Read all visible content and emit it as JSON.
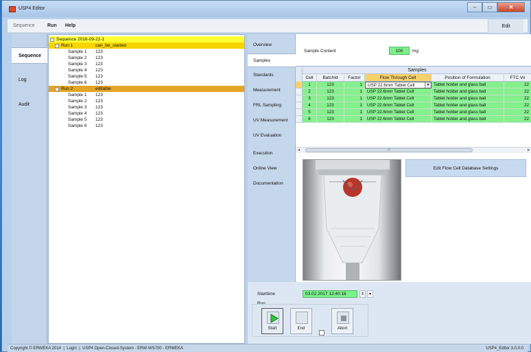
{
  "window": {
    "title": "USP4 Editor"
  },
  "menu": {
    "items": [
      "Sequence",
      "Run",
      "Help"
    ],
    "edit_label": "Edit"
  },
  "left_nav": {
    "items": [
      "Sequence",
      "Log",
      "Audit"
    ],
    "active": "Sequence"
  },
  "tree": {
    "sequence": "Sequence 2016-09-22-1",
    "runs": [
      {
        "name": "Run 1",
        "status": "can_be_started",
        "samples": [
          {
            "name": "Sample 1",
            "value": "123"
          },
          {
            "name": "Sample 2",
            "value": "123"
          },
          {
            "name": "Sample 3",
            "value": "123"
          },
          {
            "name": "Sample 4",
            "value": "123"
          },
          {
            "name": "Sample 5",
            "value": "123"
          },
          {
            "name": "Sample 6",
            "value": "123"
          }
        ]
      },
      {
        "name": "Run 2",
        "status": "editable",
        "samples": [
          {
            "name": "Sample 1",
            "value": "123"
          },
          {
            "name": "Sample 2",
            "value": "123"
          },
          {
            "name": "Sample 3",
            "value": "123"
          },
          {
            "name": "Sample 4",
            "value": "123"
          },
          {
            "name": "Sample 5",
            "value": "123"
          },
          {
            "name": "Sample 6",
            "value": "123"
          }
        ]
      }
    ]
  },
  "right_nav": {
    "items": [
      "Overview",
      "Samples",
      "Standards",
      "Measurement",
      "FRL Sampling",
      "UV Measurement",
      "UV Evaluation",
      "Execution",
      "Online View",
      "Documentation"
    ],
    "active": "Samples"
  },
  "samples": {
    "content_label": "Sample Content",
    "content_value": "100",
    "content_unit": "mg",
    "grid_title": "Samples",
    "columns": [
      "Cell",
      "BatchId",
      "Factor",
      "Flow Through Cell",
      "Position of Formulation",
      "FTC Vo"
    ],
    "rows": [
      [
        "1",
        "123",
        "1",
        "USP 22.6mm Tablet Cell",
        "Tablet holder and glass ball",
        "22"
      ],
      [
        "2",
        "123",
        "1",
        "USP 22.6mm Tablet Cell",
        "Tablet holder and glass ball",
        "22"
      ],
      [
        "3",
        "123",
        "1",
        "USP 22.6mm Tablet Cell",
        "Tablet holder and glass ball",
        "22"
      ],
      [
        "4",
        "123",
        "1",
        "USP 22.6mm Tablet Cell",
        "Tablet holder and glass ball",
        "22"
      ],
      [
        "5",
        "123",
        "1",
        "USP 22.6mm Tablet Cell",
        "Tablet holder and glass ball",
        "22"
      ],
      [
        "6",
        "123",
        "1",
        "USP 22.6mm Tablet Cell",
        "Tablet holder and glass ball",
        "22"
      ]
    ],
    "selected_column": "Flow Through Cell",
    "edit_flow_button": "Edit Flow Cell Database Settings"
  },
  "execution": {
    "starttime_label": "Starttime",
    "starttime_value": "03.02.2017 12:40:18",
    "run_label": "Run",
    "buttons": {
      "start": "Start",
      "end": "End",
      "abort": "Abort"
    }
  },
  "status": {
    "left": "Copyright © ERWEKA 2014  |  Login  |  USP4 Open-Closed-System - ERW-WS700 - ERWEKA",
    "right": "USP4_Editor 3.0.0.0"
  },
  "colors": {
    "selection_yellow": "#ffff32",
    "run1": "#f6d400",
    "run2": "#e3a525",
    "green": "#86ef8e"
  }
}
